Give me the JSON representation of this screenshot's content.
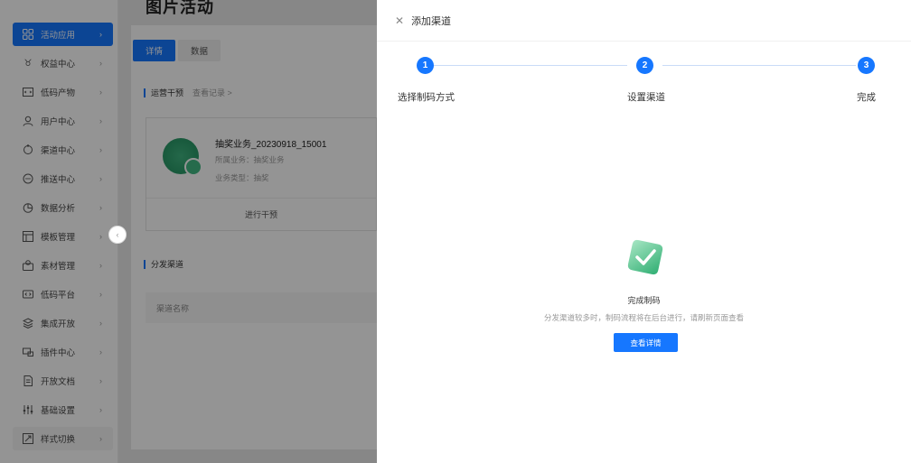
{
  "sidebar": {
    "items": [
      {
        "label": "活动应用",
        "icon": "grid-icon",
        "active": true
      },
      {
        "label": "权益中心",
        "icon": "gift-icon"
      },
      {
        "label": "低码产物",
        "icon": "code-box-icon"
      },
      {
        "label": "用户中心",
        "icon": "user-icon"
      },
      {
        "label": "渠道中心",
        "icon": "channel-icon"
      },
      {
        "label": "推送中心",
        "icon": "push-icon"
      },
      {
        "label": "数据分析",
        "icon": "pie-chart-icon"
      },
      {
        "label": "模板管理",
        "icon": "layout-icon"
      },
      {
        "label": "素材管理",
        "icon": "material-icon"
      },
      {
        "label": "低码平台",
        "icon": "code-platform-icon"
      },
      {
        "label": "集成开放",
        "icon": "layers-icon"
      },
      {
        "label": "插件中心",
        "icon": "plugin-icon"
      },
      {
        "label": "开放文档",
        "icon": "document-icon"
      },
      {
        "label": "基础设置",
        "icon": "settings-sliders-icon"
      },
      {
        "label": "样式切换",
        "icon": "style-switch-icon"
      }
    ]
  },
  "background": {
    "title": "图片活动",
    "tabs": {
      "detail": "详情",
      "data": "数据"
    },
    "ops_section": {
      "title": "运营干预",
      "sub": "查看记录 >"
    },
    "product": {
      "name": "抽奖业务_20230918_15001",
      "meta_business": "所属业务：抽奖业务",
      "meta_type": "业务类型：抽奖",
      "action": "进行干预"
    },
    "channel_section": {
      "title": "分发渠道"
    },
    "table": {
      "col_name": "渠道名称"
    }
  },
  "drawer": {
    "title": "添加渠道",
    "steps": [
      {
        "num": "1",
        "label": "选择制码方式"
      },
      {
        "num": "2",
        "label": "设置渠道"
      },
      {
        "num": "3",
        "label": "完成"
      }
    ],
    "result": {
      "title": "完成制码",
      "desc": "分发渠道较多时，制码流程将在后台进行，请刷新页面查看",
      "button": "查看详情"
    }
  },
  "colors": {
    "primary": "#1677ff",
    "success": "#3fb37f",
    "overlay": "rgba(0,0,0,0.42)"
  }
}
